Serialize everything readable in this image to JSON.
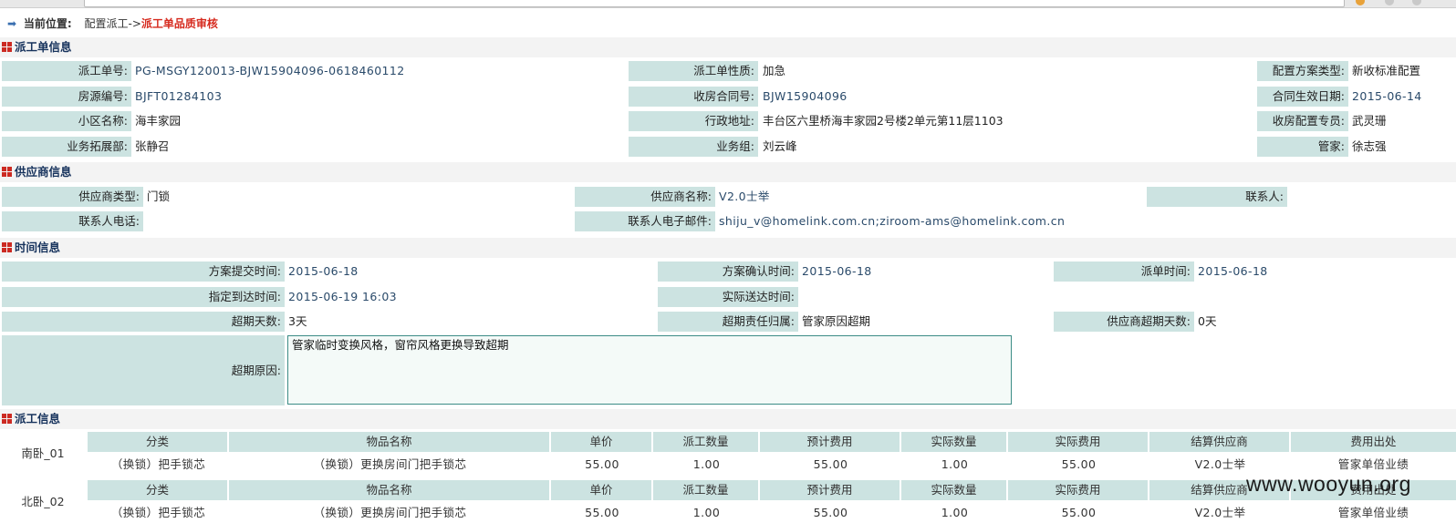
{
  "location": {
    "label": "当前位置:",
    "path": "配置派工->",
    "current": "派工单品质审核"
  },
  "sections": {
    "order_info": "派工单信息",
    "supplier_info": "供应商信息",
    "time_info": "时间信息",
    "dispatch_info": "派工信息"
  },
  "order": {
    "order_no_label": "派工单号:",
    "order_no": "PG-MSGY120013-BJW15904096-0618460112",
    "nature_label": "派工单性质:",
    "nature": "加急",
    "plan_type_label": "配置方案类型:",
    "plan_type": "新收标准配置",
    "house_no_label": "房源编号:",
    "house_no": "BJFT01284103",
    "contract_no_label": "收房合同号:",
    "contract_no": "BJW15904096",
    "effective_date_label": "合同生效日期:",
    "effective_date": "2015-06-14",
    "community_label": "小区名称:",
    "community": "海丰家园",
    "address_label": "行政地址:",
    "address": "丰台区六里桥海丰家园2号楼2单元第11层1103",
    "specialist_label": "收房配置专员:",
    "specialist": "武灵珊",
    "dept_label": "业务拓展部:",
    "dept": "张静召",
    "group_label": "业务组:",
    "group": "刘云峰",
    "steward_label": "管家:",
    "steward": "徐志强"
  },
  "supplier": {
    "type_label": "供应商类型:",
    "type": "门锁",
    "name_label": "供应商名称:",
    "name": "V2.0士举",
    "contact_label": "联系人:",
    "contact": "",
    "phone_label": "联系人电话:",
    "phone": "",
    "email_label": "联系人电子邮件:",
    "email": "shiju_v@homelink.com.cn;ziroom-ams@homelink.com.cn"
  },
  "time": {
    "submit_label": "方案提交时间:",
    "submit": "2015-06-18",
    "confirm_label": "方案确认时间:",
    "confirm": "2015-06-18",
    "dispatch_label": "派单时间:",
    "dispatch": "2015-06-18",
    "arrive_label": "指定到达时间:",
    "arrive": "2015-06-19 16:03",
    "actual_label": "实际送达时间:",
    "actual": "",
    "overdue_days_label": "超期天数:",
    "overdue_days": "3天",
    "responsibility_label": "超期责任归属:",
    "responsibility": "管家原因超期",
    "supplier_overdue_label": "供应商超期天数:",
    "supplier_overdue": "0天",
    "reason_label": "超期原因:",
    "reason": "管家临时变换风格，窗帘风格更换导致超期"
  },
  "dispatch_table": {
    "headers": [
      "分类",
      "物品名称",
      "单价",
      "派工数量",
      "预计费用",
      "实际数量",
      "实际费用",
      "结算供应商",
      "费用出处"
    ],
    "rooms": [
      {
        "room": "南卧_01",
        "row": [
          "（换锁）把手锁芯",
          "（换锁）更换房间门把手锁芯",
          "55.00",
          "1.00",
          "55.00",
          "1.00",
          "55.00",
          "V2.0士举",
          "管家单倍业绩"
        ]
      },
      {
        "room": "北卧_02",
        "row": [
          "（换锁）把手锁芯",
          "（换锁）更换房间门把手锁芯",
          "55.00",
          "1.00",
          "55.00",
          "1.00",
          "55.00",
          "V2.0士举",
          "管家单倍业绩"
        ]
      }
    ]
  },
  "watermark": "www.wooyun.org"
}
